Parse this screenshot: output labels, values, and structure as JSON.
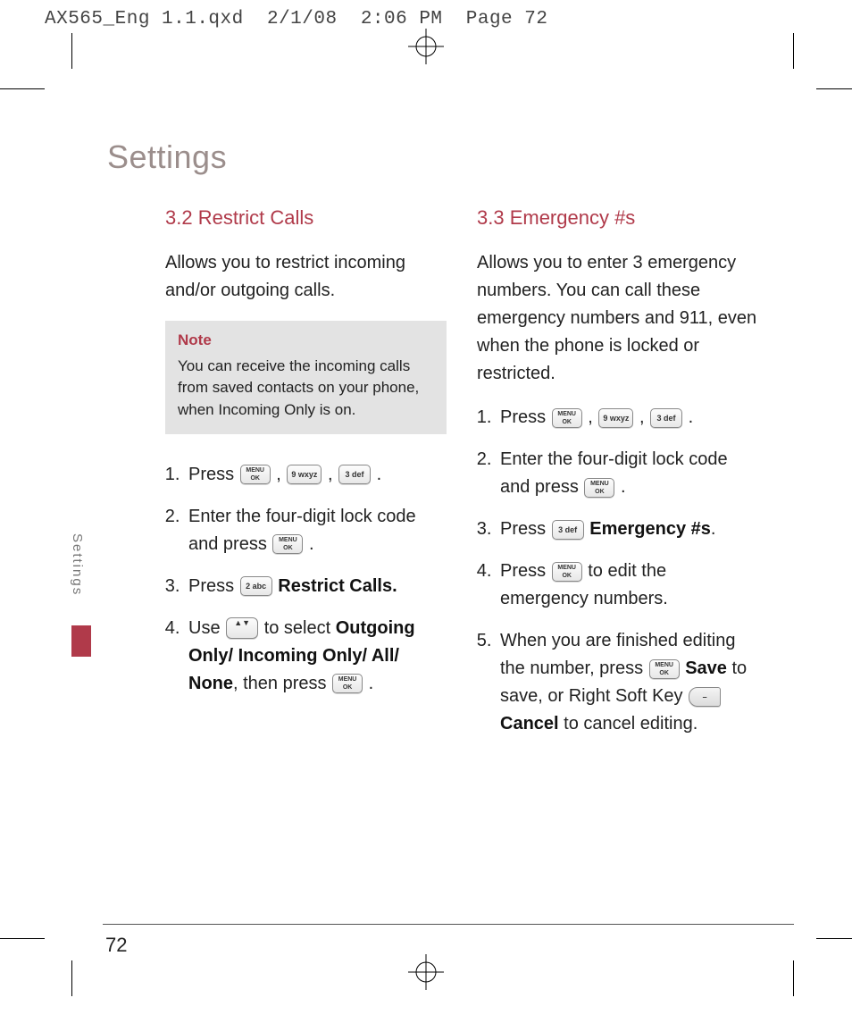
{
  "preflight": {
    "filename": "AX565_Eng 1.1.qxd",
    "date": "2/1/08",
    "time": "2:06 PM",
    "page_label": "Page 72"
  },
  "page": {
    "title": "Settings",
    "side_tab": "Settings",
    "number": "72"
  },
  "icons": {
    "menu_ok_line1": "MENU",
    "menu_ok_line2": "OK",
    "key9": "9 wxyz",
    "key3": "3 def",
    "key2": "2 abc",
    "nav_glyph": "▲▼",
    "soft_dash": "–"
  },
  "left": {
    "heading": "3.2 Restrict Calls",
    "intro": "Allows you to restrict incoming and/or outgoing calls.",
    "note_label": "Note",
    "note_body": "You can receive the incoming calls from saved contacts on your phone, when Incoming Only is on.",
    "step1_a": "Press ",
    "step1_comma": " , ",
    "step1_end": " .",
    "step2_a": "Enter the four-digit lock code and press ",
    "step2_end": " .",
    "step3_a": "Press ",
    "step3_bold": "Restrict Calls.",
    "step4_a": "Use ",
    "step4_b": " to select ",
    "step4_bold": "Outgoing Only/ Incoming Only/ All/ None",
    "step4_c": ", then press ",
    "step4_end": " ."
  },
  "right": {
    "heading": "3.3 Emergency #s",
    "intro": "Allows you to enter 3 emergency numbers. You can call these emergency numbers and 911, even when the phone is locked or restricted.",
    "step1_a": "Press ",
    "step1_comma": " , ",
    "step1_end": " .",
    "step2_a": "Enter the four-digit lock code and press ",
    "step2_end": " .",
    "step3_a": "Press ",
    "step3_bold": "Emergency #s",
    "step3_end": ".",
    "step4_a": "Press ",
    "step4_b": " to edit the emergency numbers.",
    "step5_a": "When you are finished editing the number, press ",
    "step5_bold1": "Save",
    "step5_b": " to save, or Right Soft Key ",
    "step5_bold2": "Cancel",
    "step5_c": " to cancel editing."
  }
}
